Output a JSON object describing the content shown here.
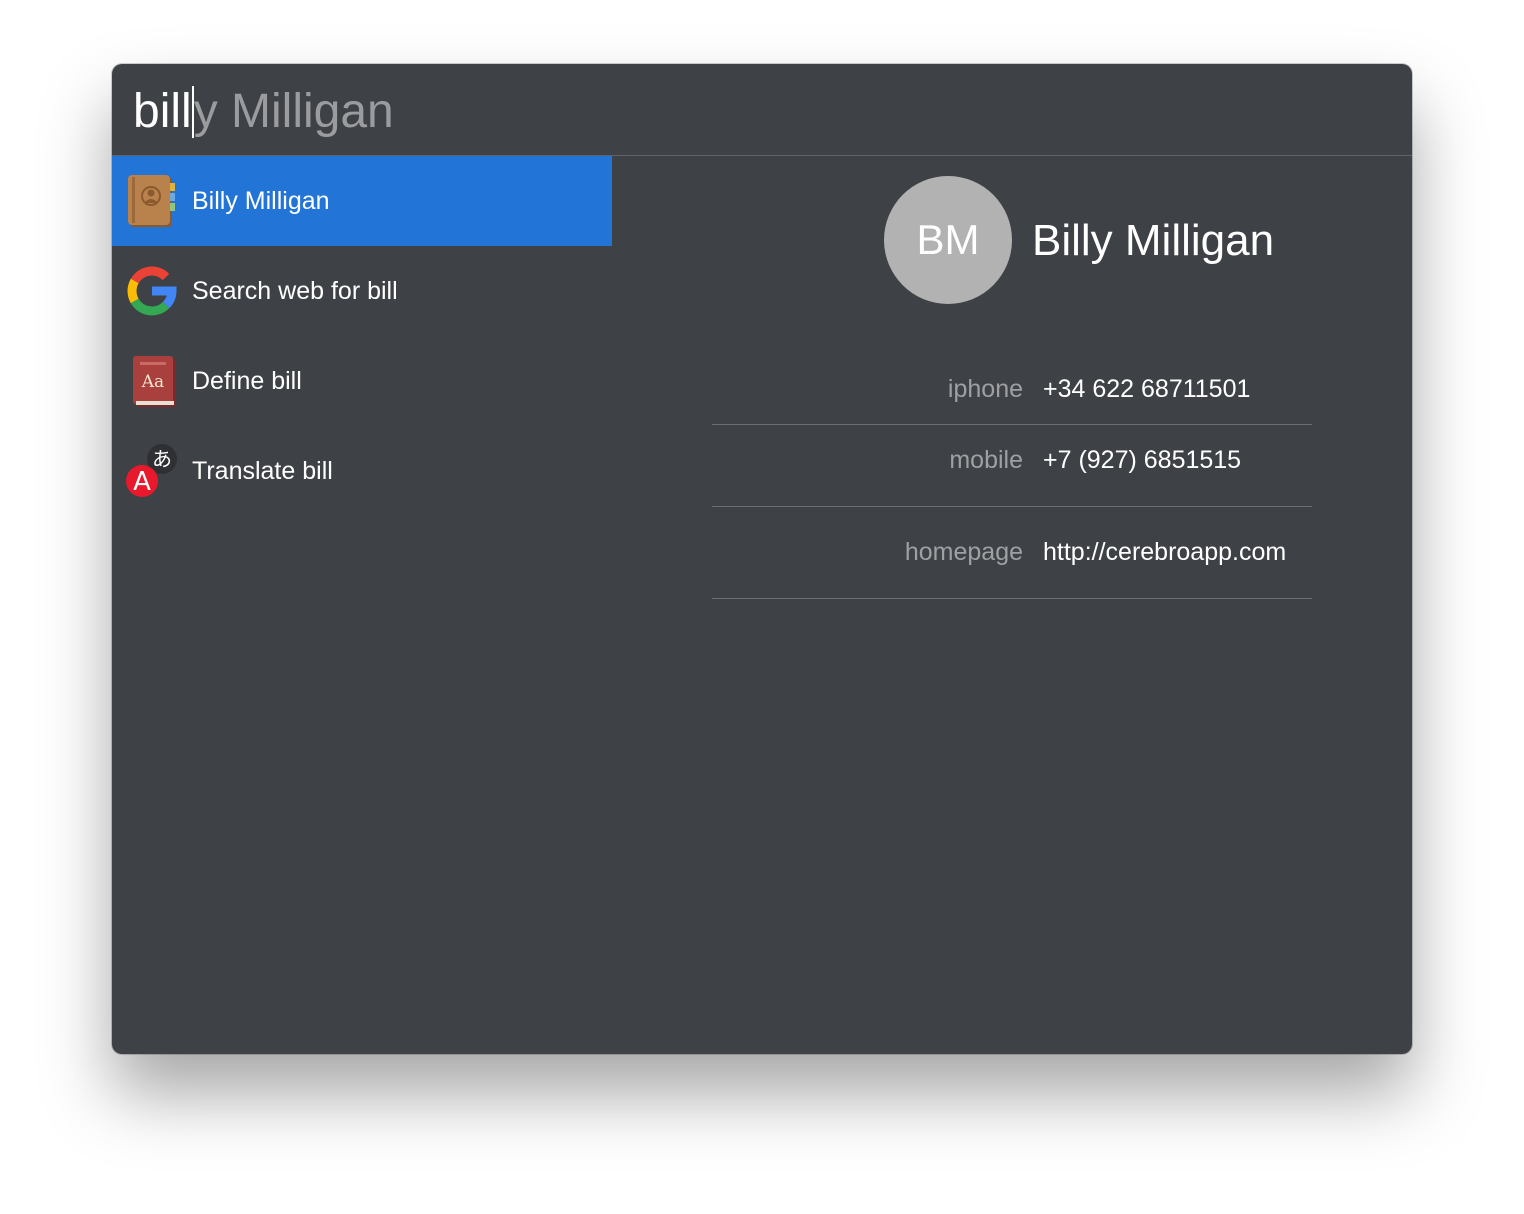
{
  "search": {
    "typed": "bill",
    "autocomplete": "y Milligan"
  },
  "results": [
    {
      "label": "Billy Milligan",
      "icon": "contacts-book-icon",
      "selected": true
    },
    {
      "label": "Search web for bill",
      "icon": "google-icon",
      "selected": false
    },
    {
      "label": "Define bill",
      "icon": "dictionary-icon",
      "selected": false
    },
    {
      "label": "Translate bill",
      "icon": "translate-icon",
      "selected": false
    }
  ],
  "contact": {
    "initials": "BM",
    "name": "Billy Milligan",
    "fields": [
      {
        "label": "iphone",
        "value": "+34 622 68711501"
      },
      {
        "label": "mobile",
        "value": "+7 (927) 6851515"
      },
      {
        "label": "homepage",
        "value": "http://cerebroapp.com"
      }
    ]
  },
  "colors": {
    "window_bg": "#3e4145",
    "selection": "#2274d7",
    "avatar_bg": "#b2b2b2",
    "muted_text": "#9ea0a3"
  }
}
